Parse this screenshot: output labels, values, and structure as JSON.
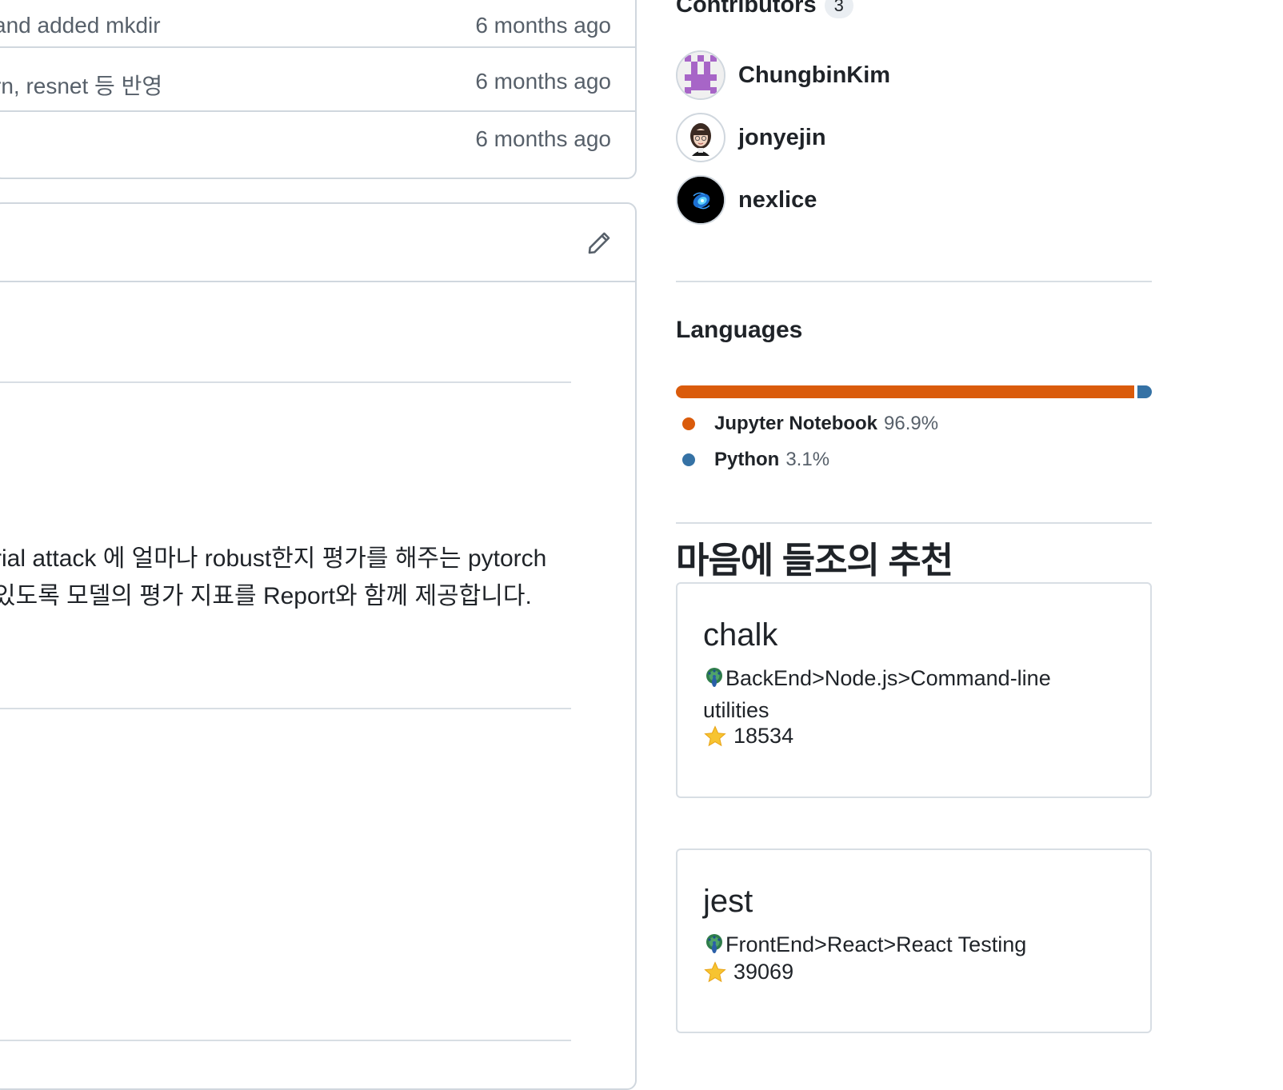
{
  "commits": [
    {
      "message": "and added mkdir",
      "time": "6 months ago"
    },
    {
      "message": "rn, resnet 등 반영",
      "time": "6 months ago"
    },
    {
      "message": "",
      "time": "6 months ago"
    }
  ],
  "readme": {
    "description_lines": [
      "rial attack 에 얼마나 robust한지 평가를 해주는 pytorch",
      "있도록 모델의 평가 지표를 Report와 함께 제공합니다."
    ]
  },
  "contributors": {
    "heading": "Contributors",
    "count": "3",
    "list": [
      {
        "name": "ChungbinKim",
        "avatar": "identicon-avatar"
      },
      {
        "name": "jonyejin",
        "avatar": "memoji-avatar"
      },
      {
        "name": "nexlice",
        "avatar": "galaxy-avatar"
      }
    ]
  },
  "languages": {
    "heading": "Languages",
    "items": [
      {
        "name": "Jupyter Notebook",
        "percent": "96.9%",
        "value": 96.9,
        "color": "#DA5B0B"
      },
      {
        "name": "Python",
        "percent": "3.1%",
        "value": 3.1,
        "color": "#3572A5"
      }
    ]
  },
  "recommendations": {
    "heading": "마음에 들조의 추천",
    "cards": [
      {
        "name": "chalk",
        "category": "BackEnd>Node.js>Command-line utilities",
        "stars": "18534"
      },
      {
        "name": "jest",
        "category": "FrontEnd>React>React Testing",
        "stars": "39069"
      }
    ]
  },
  "icons": {
    "edit": "pencil-icon",
    "star": "star-icon",
    "category": "peacock-icon"
  }
}
